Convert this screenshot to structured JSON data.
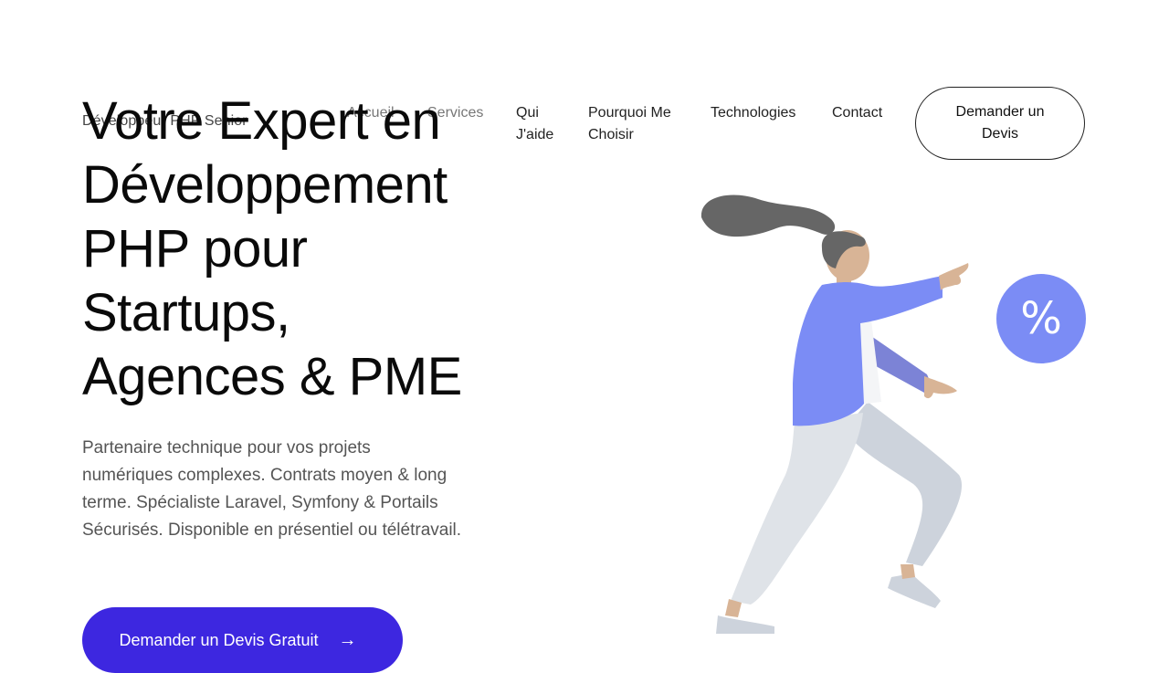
{
  "header": {
    "brand": "Développeur PHP Senior",
    "nav": [
      "Accueil",
      "Services",
      "Qui J'aide",
      "Pourquoi Me Choisir",
      "Technologies",
      "Contact"
    ],
    "cta": "Demander un Devis"
  },
  "hero": {
    "title_lines": [
      "Votre Expert en",
      "Développement",
      "PHP pour",
      "Startups,",
      "Agences & PME"
    ],
    "description": "Partenaire technique pour vos projets numériques complexes. Contrats moyen & long terme. Spécialiste Laravel, Symfony & Portails Sécurisés. Disponible en présentiel ou télétravail.",
    "cta": "Demander un Devis Gratuit",
    "cta_icon": "arrow-right-icon"
  },
  "illustration": {
    "badge_symbol": "%",
    "badge_color": "#7b8cf5",
    "accent_color": "#3d27e0"
  }
}
